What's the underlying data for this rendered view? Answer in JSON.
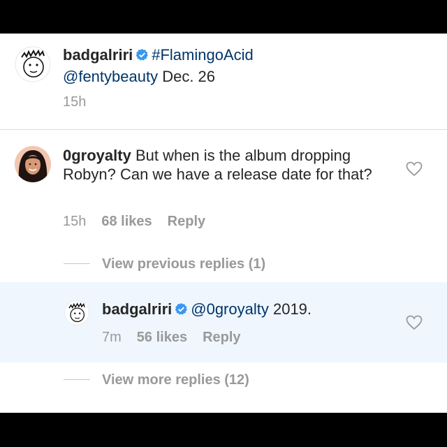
{
  "caption": {
    "username": "badgalriri",
    "hashtag": "#FlamingoAcid",
    "mention": "@fentybeauty",
    "text": " Dec. 26",
    "time": "15h"
  },
  "comment": {
    "username": "0groyalty",
    "text": " But when is the album dropping Robyn? Can we have a release date for that?",
    "time": "15h",
    "likes": "68 likes",
    "reply_label": "Reply"
  },
  "view_previous": "View previous replies (1)",
  "reply": {
    "username": "badgalriri",
    "mention": "@0groyalty",
    "text": " 2019.",
    "time": "7m",
    "likes": "56 likes",
    "reply_label": "Reply"
  },
  "view_more": "View more replies (12)",
  "colors": {
    "verified": "#3897f0",
    "link": "#003569",
    "meta": "#999999",
    "highlight": "#eff6fe"
  }
}
